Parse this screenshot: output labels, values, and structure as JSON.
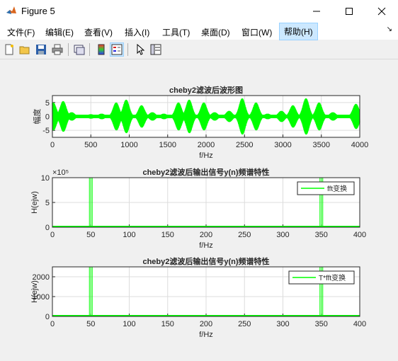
{
  "window": {
    "title": "Figure 5"
  },
  "menu": [
    "文件(F)",
    "编辑(E)",
    "查看(V)",
    "插入(I)",
    "工具(T)",
    "桌面(D)",
    "窗口(W)",
    "帮助(H)"
  ],
  "toolbar": [
    "new-figure-icon",
    "open-file-icon",
    "save-icon",
    "print-icon",
    "link-plot-icon",
    "colorbar-icon",
    "legend-icon",
    "pointer-icon",
    "property-editor-icon"
  ],
  "colors": {
    "signal": "#00ff00",
    "grid": "#dcdcdc",
    "axes_bg": "#ffffff"
  },
  "plots": [
    {
      "title": "cheby2滤波后波形图",
      "xlabel": "f/Hz",
      "ylabel": "幅度",
      "xticks": [
        "0",
        "500",
        "1000",
        "1500",
        "2000",
        "2500",
        "3000",
        "3500",
        "4000"
      ],
      "yticks": [
        "5",
        "0",
        "-5"
      ],
      "exponent": "",
      "legend": ""
    },
    {
      "title": "cheby2滤波后输出信号y(n)频谱特性",
      "xlabel": "f/Hz",
      "ylabel": "H(ejw)",
      "xticks": [
        "0",
        "50",
        "100",
        "150",
        "200",
        "250",
        "300",
        "350",
        "400"
      ],
      "yticks": [
        "10",
        "5",
        "0"
      ],
      "exponent": "×10⁵",
      "legend": "fft变换"
    },
    {
      "title": "cheby2滤波后输出信号y(n)频谱特性",
      "xlabel": "f/Hz",
      "ylabel": "H(ejw)",
      "xticks": [
        "0",
        "50",
        "100",
        "150",
        "200",
        "250",
        "300",
        "350",
        "400"
      ],
      "yticks": [
        "2000",
        "1000",
        "0"
      ],
      "exponent": "",
      "legend": "T*fft变换"
    }
  ],
  "chart_data": [
    {
      "type": "line",
      "title": "cheby2滤波后波形图",
      "xlabel": "f/Hz",
      "ylabel": "幅度",
      "xlim": [
        0,
        4000
      ],
      "ylim": [
        -7.5,
        7.5
      ],
      "grid": true,
      "series": [
        {
          "envelope_peaks_x": [
            10,
            140,
            250,
            500,
            640,
            830,
            960,
            1160,
            1300,
            1450,
            1640,
            1780,
            1970,
            2110,
            2300,
            2470,
            2650,
            2800,
            2980,
            3130,
            3300,
            3470,
            3650,
            3950
          ],
          "envelope_peaks_y": [
            5,
            5.5,
            1.5,
            0.8,
            1,
            5,
            6,
            4,
            1.5,
            1,
            5,
            6,
            5,
            1.5,
            2,
            6.5,
            5,
            1,
            2,
            4,
            6.5,
            5,
            1.5,
            4.5
          ]
        }
      ]
    },
    {
      "type": "line",
      "title": "cheby2滤波后输出信号y(n)频谱特性",
      "xlabel": "f/Hz",
      "ylabel": "H(ejw)",
      "xlim": [
        0,
        400
      ],
      "ylim": [
        0,
        1000000
      ],
      "grid": true,
      "legend": "top-right",
      "series": [
        {
          "name": "fft变换",
          "x": [
            50,
            350
          ],
          "y": [
            1000000,
            1000000
          ]
        }
      ]
    },
    {
      "type": "line",
      "title": "cheby2滤波后输出信号y(n)频谱特性",
      "xlabel": "f/Hz",
      "ylabel": "H(ejw)",
      "xlim": [
        0,
        400
      ],
      "ylim": [
        0,
        2500
      ],
      "grid": true,
      "legend": "top-right",
      "series": [
        {
          "name": "T*fft变换",
          "x": [
            50,
            350
          ],
          "y": [
            2500,
            2500
          ]
        }
      ]
    }
  ]
}
